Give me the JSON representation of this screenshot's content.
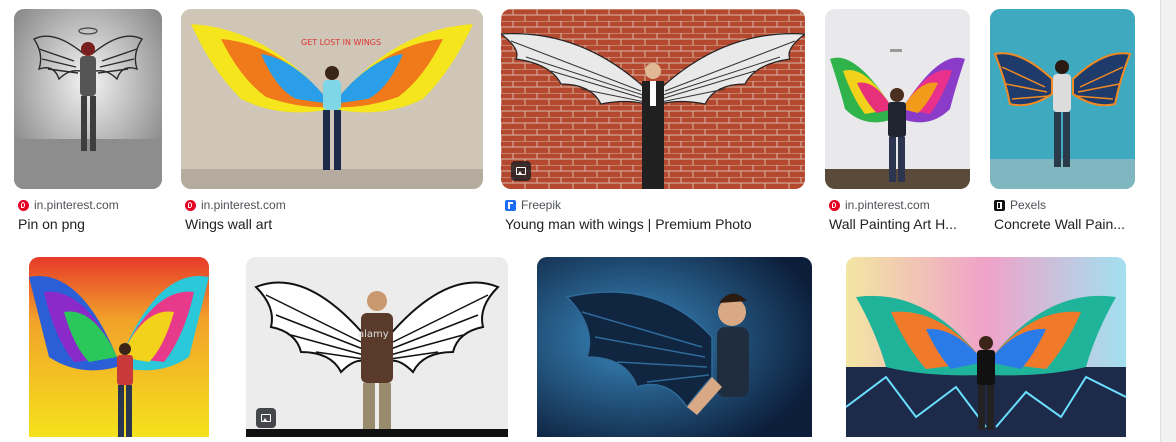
{
  "results": [
    {
      "source": "in.pinterest.com",
      "source_icon": "pinterest-icon",
      "title": "Pin on png"
    },
    {
      "source": "in.pinterest.com",
      "source_icon": "pinterest-icon",
      "title": "Wings wall art"
    },
    {
      "source": "Freepik",
      "source_icon": "freepik-icon",
      "title": "Young man with wings | Premium Photo"
    },
    {
      "source": "in.pinterest.com",
      "source_icon": "pinterest-icon",
      "title": "Wall Painting Art H..."
    },
    {
      "source": "Pexels",
      "source_icon": "pexels-icon",
      "title": "Concrete Wall Pain..."
    }
  ],
  "colors": {
    "pinterest": "#e60023",
    "freepik": "#1e6ef5",
    "pexels": "#111111",
    "text_primary": "#202124",
    "text_secondary": "#4d5156"
  }
}
